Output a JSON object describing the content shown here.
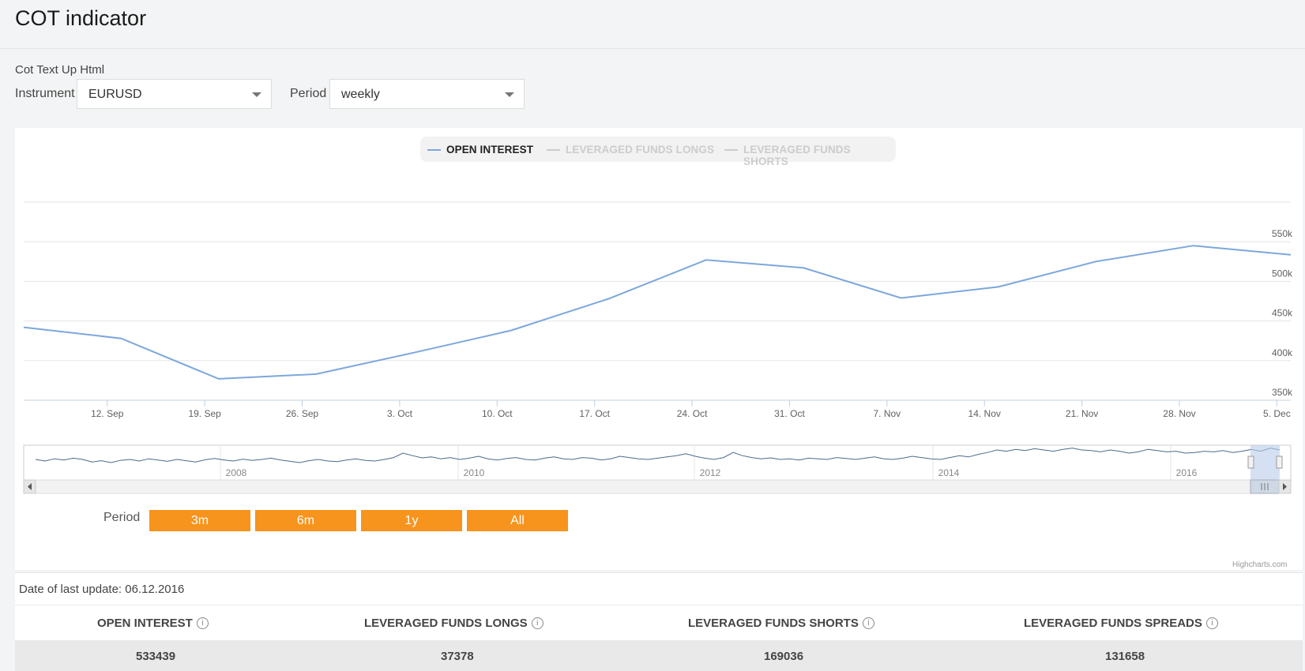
{
  "header": {
    "title": "COT indicator"
  },
  "controls": {
    "subtext": "Cot Text Up Html",
    "instrument_label": "Instrument",
    "instrument_value": "EURUSD",
    "period_label": "Period",
    "period_value": "weekly"
  },
  "legend": [
    {
      "label": "OPEN INTEREST",
      "color": "#7ca7dc",
      "active": true
    },
    {
      "label": "LEVERAGED FUNDS LONGS",
      "color": "#cccccc",
      "active": false
    },
    {
      "label": "LEVERAGED FUNDS SHORTS",
      "color": "#cccccc",
      "active": false
    }
  ],
  "chart_data": {
    "type": "line",
    "x": [
      "12. Sep",
      "19. Sep",
      "26. Sep",
      "3. Oct",
      "10. Oct",
      "17. Oct",
      "24. Oct",
      "31. Oct",
      "7. Nov",
      "14. Nov",
      "21. Nov",
      "28. Nov",
      "5. Dec"
    ],
    "series": [
      {
        "name": "OPEN INTEREST",
        "color": "#7ca7dc",
        "points": [
          {
            "date": "2016-09-06",
            "value": 442000
          },
          {
            "date": "2016-09-13",
            "value": 428000
          },
          {
            "date": "2016-09-20",
            "value": 377000
          },
          {
            "date": "2016-09-27",
            "value": 383000
          },
          {
            "date": "2016-10-04",
            "value": 410000
          },
          {
            "date": "2016-10-11",
            "value": 438000
          },
          {
            "date": "2016-10-18",
            "value": 478000
          },
          {
            "date": "2016-10-25",
            "value": 527000
          },
          {
            "date": "2016-11-01",
            "value": 517000
          },
          {
            "date": "2016-11-08",
            "value": 479000
          },
          {
            "date": "2016-11-15",
            "value": 493000
          },
          {
            "date": "2016-11-22",
            "value": 525000
          },
          {
            "date": "2016-11-29",
            "value": 545000
          },
          {
            "date": "2016-12-06",
            "value": 533439
          }
        ]
      }
    ],
    "y_ticks": [
      "350k",
      "400k",
      "450k",
      "500k",
      "550k"
    ],
    "ylim": [
      350000,
      600000
    ],
    "grid": true,
    "legend_position": "top-center",
    "navigator": {
      "x_ticks": [
        "2008",
        "2010",
        "2012",
        "2014",
        "2016"
      ],
      "values": [
        0.6,
        0.55,
        0.62,
        0.58,
        0.64,
        0.6,
        0.52,
        0.56,
        0.5,
        0.57,
        0.6,
        0.55,
        0.62,
        0.58,
        0.54,
        0.6,
        0.56,
        0.52,
        0.59,
        0.63,
        0.58,
        0.55,
        0.61,
        0.57,
        0.6,
        0.64,
        0.58,
        0.54,
        0.5,
        0.56,
        0.6,
        0.55,
        0.53,
        0.58,
        0.62,
        0.57,
        0.55,
        0.6,
        0.66,
        0.8,
        0.72,
        0.65,
        0.68,
        0.62,
        0.66,
        0.6,
        0.64,
        0.7,
        0.62,
        0.58,
        0.63,
        0.66,
        0.6,
        0.58,
        0.64,
        0.68,
        0.62,
        0.6,
        0.66,
        0.64,
        0.58,
        0.62,
        0.7,
        0.66,
        0.62,
        0.6,
        0.64,
        0.68,
        0.72,
        0.78,
        0.7,
        0.64,
        0.6,
        0.66,
        0.82,
        0.72,
        0.66,
        0.62,
        0.65,
        0.6,
        0.62,
        0.58,
        0.64,
        0.62,
        0.6,
        0.66,
        0.63,
        0.6,
        0.64,
        0.68,
        0.62,
        0.6,
        0.64,
        0.7,
        0.66,
        0.62,
        0.6,
        0.66,
        0.72,
        0.68,
        0.76,
        0.82,
        0.9,
        0.86,
        0.92,
        0.88,
        0.94,
        0.9,
        0.86,
        0.92,
        0.96,
        0.9,
        0.88,
        0.84,
        0.9,
        0.86,
        0.8,
        0.84,
        0.92,
        0.88,
        0.84,
        0.86,
        0.8,
        0.82,
        0.86,
        0.84,
        0.88,
        0.82,
        0.86,
        0.92,
        0.86,
        0.96,
        0.9
      ]
    }
  },
  "period_buttons": {
    "label": "Period",
    "buttons": [
      "3m",
      "6m",
      "1y",
      "All"
    ]
  },
  "credits": "Highcharts.com",
  "last_update": "Date of last update: 06.12.2016",
  "stats": {
    "headers": [
      "OPEN INTEREST",
      "LEVERAGED FUNDS LONGS",
      "LEVERAGED FUNDS SHORTS",
      "LEVERAGED FUNDS SPREADS"
    ],
    "values": [
      "533439",
      "37378",
      "169036",
      "131658"
    ],
    "info_glyph": "i"
  }
}
